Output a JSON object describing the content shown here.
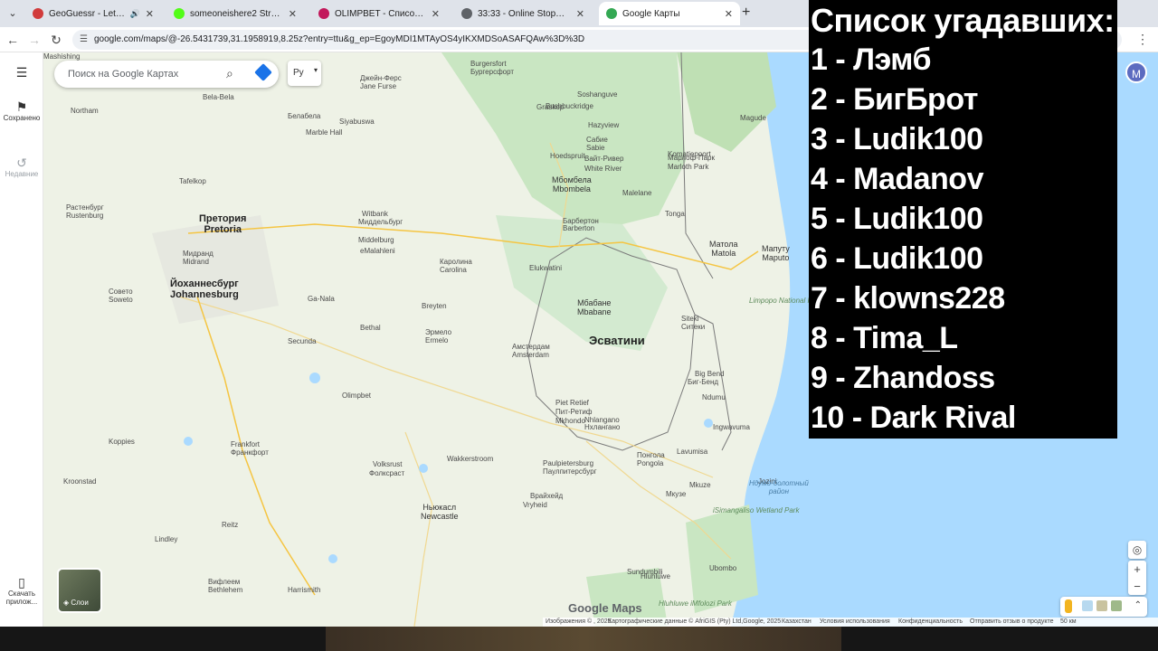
{
  "browser": {
    "tabs": [
      {
        "label": "GeoGuessr - Let's explore th",
        "favicon_color": "#d13b3b",
        "audio": true,
        "active": false
      },
      {
        "label": "someoneishere2 Stream - Watc",
        "favicon_color": "#53fc18",
        "audio": false,
        "active": false
      },
      {
        "label": "OLIMPBET - Список спортивн",
        "favicon_color": "#c2185b",
        "audio": false,
        "active": false
      },
      {
        "label": "33:33 - Online Stopwatch - vClo",
        "favicon_color": "#5f6368",
        "audio": false,
        "active": false
      },
      {
        "label": "Google Карты",
        "favicon_color": "#34a853",
        "audio": false,
        "active": true
      }
    ],
    "new_tab": "+",
    "url": "google.com/maps/@-26.5431739,31.1958919,8.25z?entry=ttu&g_ep=EgoyMDI1MTAyOS4yIKXMDSoASAFQAw%3D%3D"
  },
  "rail": {
    "saved": "Сохранено",
    "recent": "Недавние",
    "download": "Скачать прилож..."
  },
  "search": {
    "placeholder": "Поиск на Google Картах"
  },
  "language_button": "Ру",
  "layers_label": "Слои",
  "logo": "Google Maps",
  "avatar_letter": "M",
  "zoom": {
    "in": "+",
    "out": "−"
  },
  "footer": {
    "images": "Изображения © , 2025",
    "map_data": "Картографические данные © AfriGIS (Pty) Ltd,Google, 2025",
    "country": "Казахстан",
    "terms": "Условия использования",
    "privacy": "Конфиденциальность",
    "feedback": "Отправить отзыв о продукте",
    "scale": "50 км"
  },
  "map": {
    "country_label": "Эсватини",
    "cities": [
      {
        "ru": "Претория",
        "en": "Pretoria"
      },
      {
        "ru": "Йоханнесбург",
        "en": "Johannesburg"
      },
      {
        "ru": "Мбабане",
        "en": "Mbabane"
      },
      {
        "ru": "Мапуту",
        "en": "Maputo"
      },
      {
        "ru": "Матола",
        "en": "Matola"
      },
      {
        "ru": "Мбомбела",
        "en": "Mbombela"
      },
      {
        "ru": "Ньюкасл",
        "en": "Newcastle"
      },
      {
        "ru": "Растенбург",
        "en": "Rustenburg"
      },
      {
        "ru": "Мидранд",
        "en": "Midrand"
      },
      {
        "ru": "Совето",
        "en": "Soweto"
      }
    ],
    "small_labels": [
      "Burgersfort",
      "Бургерсфорт",
      "Джейн-Ферс",
      "Jane Furse",
      "Graskop",
      "Hazyview",
      "Magude",
      "Сабие",
      "Sabie",
      "White River",
      "Вайт-Ривер",
      "Malelane",
      "Koma­tiepoort",
      "Марлоф-Парк",
      "Marloth Park",
      "Middelburg",
      "Миддельбург",
      "Witbank",
      "eMalahleni",
      "Barberton",
      "Барбертон",
      "Tonga",
      "Elukwatini",
      "Каролина",
      "Carolina",
      "Breyten",
      "Эрмело",
      "Ermelo",
      "Амстердам",
      "Amsterdam",
      "Bethal",
      "Secunda",
      "Ga-Nala",
      "Olimpbet",
      "Piet Retief",
      "Пит-Ретиф",
      "Mkhondo",
      "Nhlangano",
      "Нхлангано",
      "Lavumisa",
      "Pongola",
      "Понгола",
      "Paulpietersburg",
      "Паулпитерсбург",
      "Vryheid",
      "Врайхейд",
      "Wakkerstroom",
      "Volksrust",
      "Фолксраст",
      "Frankfort",
      "Франкфорт",
      "Koppies",
      "Kroonstad",
      "Reitz",
      "Lindley",
      "Bethlehem",
      "Вифлеем",
      "Harrismith",
      "Mkuze",
      "Мкузе",
      "Ubombo",
      "Hluhluwe",
      "Siteki",
      "Ситеки",
      "Big Bend",
      "Биг-Бенд",
      "Ndumu",
      "Jozini",
      "Ingwavuma",
      "Sundumbili",
      "Northam",
      "Bela-Bela",
      "Белабела",
      "Marble Hall",
      "Siyabuswa",
      "Tafelkop",
      "Soshanguve",
      "Bushbuckridge",
      "Hoedspruit",
      "Mashishing"
    ],
    "park_labels": [
      "Лимпопо Нэшнл Парк",
      "Limpopo National Park",
      "iSimangaliso Wetland Park",
      "Hluhluwe iMfolozi Park"
    ],
    "water_labels": [
      "Ндумо-болотный",
      "район"
    ]
  },
  "overlay": {
    "title": "Список угадавших:",
    "rows": [
      "1 - Лэмб",
      "2 - БигБрот",
      "3 - Ludik100",
      "4 - Madanov",
      "5 - Ludik100",
      "6 - Ludik100",
      "7 - klowns228",
      "8 - Tima_L",
      "9 - Zhandoss",
      "10 - Dark Rival"
    ]
  },
  "colors": {
    "land": "#eef2e6",
    "park": "#c9e6c2",
    "water": "#aadaff",
    "road": "#f5c542",
    "border": "#7a7a7a",
    "overlay_bg": "#000000",
    "overlay_text": "#ffffff"
  }
}
